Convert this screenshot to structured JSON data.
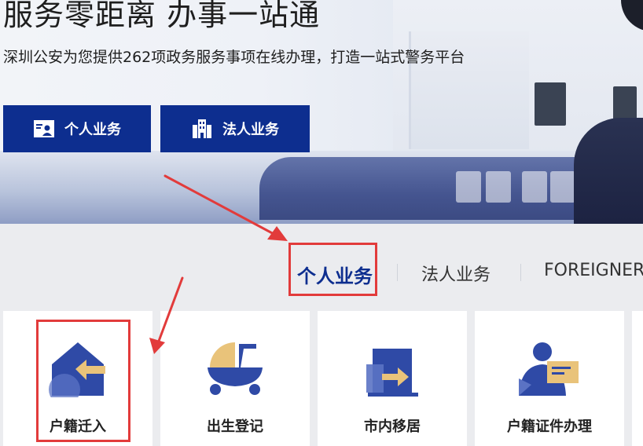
{
  "hero": {
    "title": "服务零距离 办事一站通",
    "subtitle": "深圳公安为您提供262项政务服务事项在线办理，打造一站式警务平台",
    "buttons": [
      {
        "label": "个人业务",
        "icon": "person-card-icon"
      },
      {
        "label": "法人业务",
        "icon": "building-icon"
      }
    ]
  },
  "tabs": [
    {
      "label": "个人业务",
      "active": true
    },
    {
      "label": "法人业务",
      "active": false
    },
    {
      "label": "FOREIGNER",
      "active": false
    }
  ],
  "services": [
    {
      "label": "户籍迁入",
      "icon": "house-move-in-icon"
    },
    {
      "label": "出生登记",
      "icon": "baby-stroller-icon"
    },
    {
      "label": "市内移居",
      "icon": "relocate-door-icon"
    },
    {
      "label": "户籍证件办理",
      "icon": "id-document-icon"
    }
  ],
  "colors": {
    "brand_blue": "#0d2e8f",
    "icon_blue": "#2f4aa6",
    "icon_gold": "#e9c37a",
    "annotation_red": "#e23b3b"
  }
}
